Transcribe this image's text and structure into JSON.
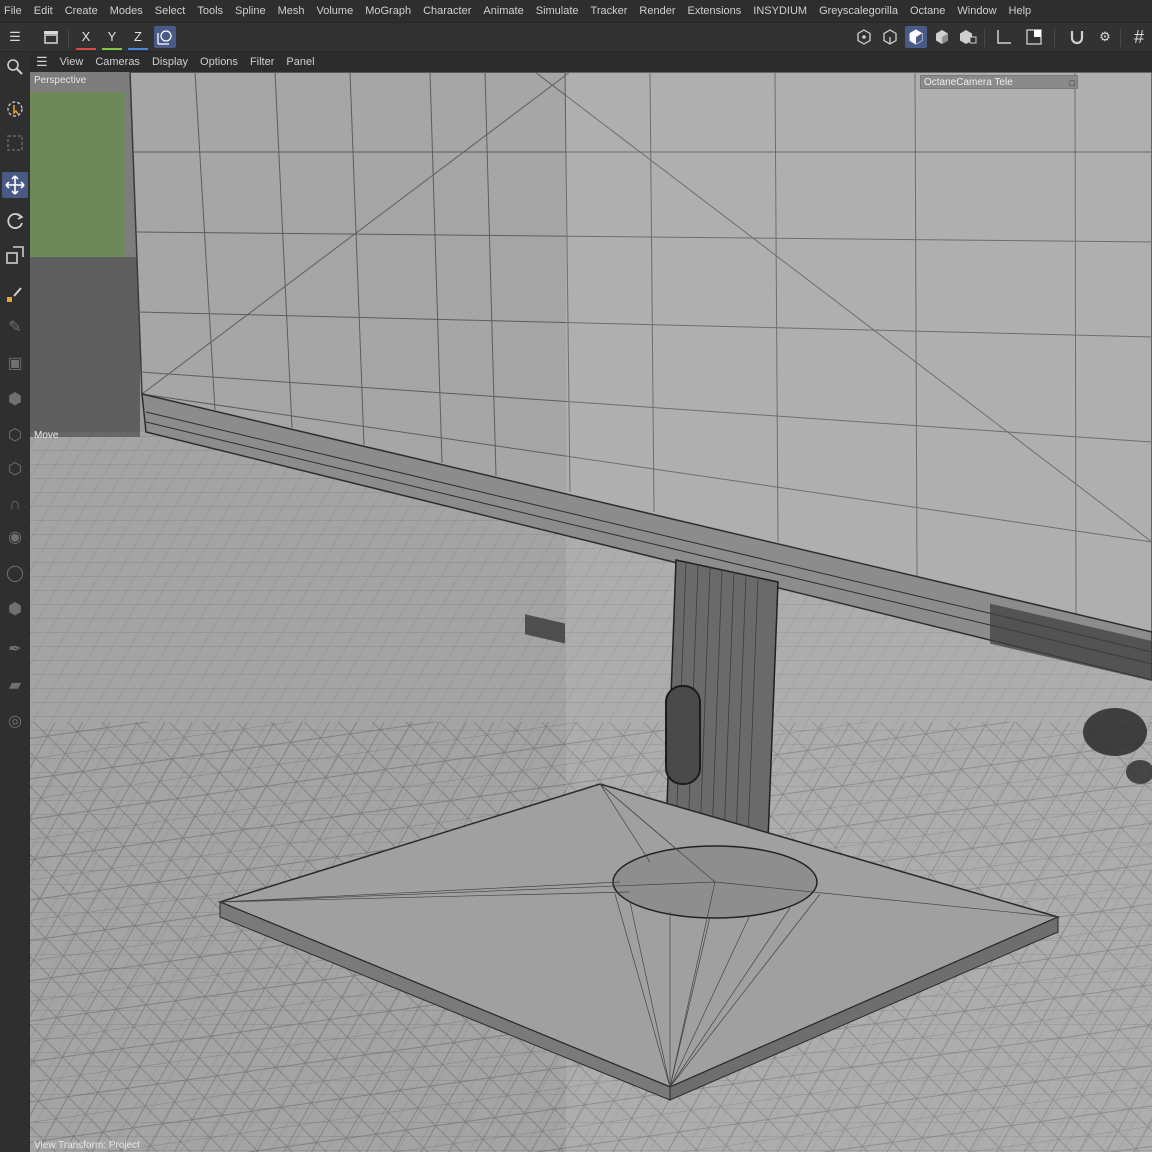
{
  "menubar": {
    "items": [
      "File",
      "Edit",
      "Create",
      "Modes",
      "Select",
      "Tools",
      "Spline",
      "Mesh",
      "Volume",
      "MoGraph",
      "Character",
      "Animate",
      "Simulate",
      "Tracker",
      "Render",
      "Extensions",
      "INSYDIUM",
      "Greyscalegorilla",
      "Octane",
      "Window",
      "Help"
    ]
  },
  "toolbar": {
    "axis_x": "X",
    "axis_y": "Y",
    "axis_z": "Z"
  },
  "viewmenu": {
    "items": [
      "View",
      "Cameras",
      "Display",
      "Options",
      "Filter",
      "Panel"
    ]
  },
  "viewport": {
    "view_label": "Perspective",
    "tool_label": "Move",
    "camera_label": "OctaneCamera Tele",
    "status_label": "View Transform: Project"
  },
  "colors": {
    "accent": "#4a5a86",
    "viewport_bg": "#9a9a9a",
    "axis_x": "#d94848",
    "axis_y": "#7ec94a",
    "axis_z": "#4a86d9"
  }
}
